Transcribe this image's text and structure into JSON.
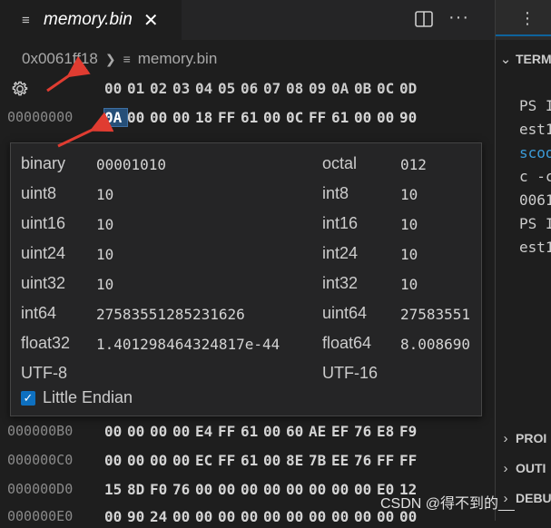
{
  "tab": {
    "title": "memory.bin",
    "close": "✕"
  },
  "breadcrumb": {
    "address": "0x0061ff18",
    "file": "memory.bin"
  },
  "hex": {
    "columns": [
      "00",
      "01",
      "02",
      "03",
      "04",
      "05",
      "06",
      "07",
      "08",
      "09",
      "0A",
      "0B",
      "0C",
      "0D"
    ],
    "rows": [
      {
        "addr": "00000000",
        "bytes": [
          "0A",
          "00",
          "00",
          "00",
          "18",
          "FF",
          "61",
          "00",
          "0C",
          "FF",
          "61",
          "00",
          "00",
          "90"
        ],
        "selected": 0
      },
      {
        "addr": "000000B0",
        "bytes": [
          "00",
          "00",
          "00",
          "00",
          "E4",
          "FF",
          "61",
          "00",
          "60",
          "AE",
          "EF",
          "76",
          "E8",
          "F9"
        ]
      },
      {
        "addr": "000000C0",
        "bytes": [
          "00",
          "00",
          "00",
          "00",
          "EC",
          "FF",
          "61",
          "00",
          "8E",
          "7B",
          "EE",
          "76",
          "FF",
          "FF"
        ]
      },
      {
        "addr": "000000D0",
        "bytes": [
          "15",
          "8D",
          "F0",
          "76",
          "00",
          "00",
          "00",
          "00",
          "00",
          "00",
          "00",
          "00",
          "E0",
          "12"
        ]
      },
      {
        "addr": "000000E0",
        "bytes": [
          "00",
          "90",
          "24",
          "00",
          "00",
          "00",
          "00",
          "00",
          "00",
          "00",
          "00",
          "00",
          "00",
          "00"
        ]
      }
    ]
  },
  "inspector": {
    "binary": {
      "label": "binary",
      "value": "00001010"
    },
    "octal": {
      "label": "octal",
      "value": "012"
    },
    "uint8": {
      "label": "uint8",
      "value": "10"
    },
    "int8": {
      "label": "int8",
      "value": "10"
    },
    "uint16": {
      "label": "uint16",
      "value": "10"
    },
    "int16": {
      "label": "int16",
      "value": "10"
    },
    "uint24": {
      "label": "uint24",
      "value": "10"
    },
    "int24": {
      "label": "int24",
      "value": "10"
    },
    "uint32": {
      "label": "uint32",
      "value": "10"
    },
    "int32": {
      "label": "int32",
      "value": "10"
    },
    "int64": {
      "label": "int64",
      "value": "27583551285231626"
    },
    "uint64": {
      "label": "uint64",
      "value": "27583551"
    },
    "float32": {
      "label": "float32",
      "value": "1.401298464324817e-44"
    },
    "float64": {
      "label": "float64",
      "value": "8.008690"
    },
    "utf8": {
      "label": "UTF-8",
      "value": ""
    },
    "utf16": {
      "label": "UTF-16",
      "value": ""
    },
    "little_endian": {
      "label": "Little Endian",
      "checked": true
    }
  },
  "panel": {
    "terminal_title": "TERM",
    "terminal_lines": [
      "PS I",
      "est1",
      "scoo",
      "c -c",
      "0061",
      "PS I",
      "est1"
    ],
    "sections": [
      "PROI",
      "OUTI",
      "DEBU"
    ]
  },
  "watermark": "CSDN @得不到的__",
  "colors": {
    "accent": "#0e70c0",
    "selection": "#264f78",
    "annotation": "#e03c31"
  }
}
